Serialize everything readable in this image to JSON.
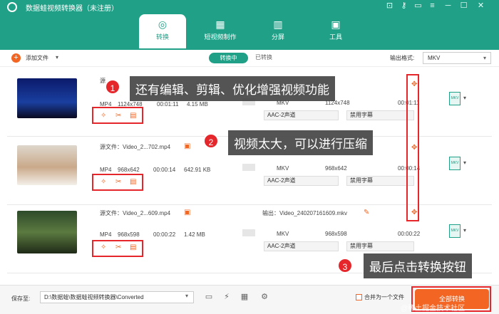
{
  "app": {
    "title": "数据蛙视频转换器（未注册）"
  },
  "tabs": [
    {
      "label": "转换",
      "icon": "convert-icon"
    },
    {
      "label": "短视频制作",
      "icon": "short-video-icon"
    },
    {
      "label": "分屏",
      "icon": "split-screen-icon"
    },
    {
      "label": "工具",
      "icon": "toolbox-icon"
    }
  ],
  "toolbar": {
    "add_files": "添加文件",
    "converting": "转换中",
    "converted": "已转换",
    "output_format_label": "输出格式:",
    "output_format": "MKV"
  },
  "rows": [
    {
      "src": "源",
      "meta_format": "MP4",
      "meta_size": "1124x748",
      "meta_duration": "00:01:11",
      "meta_filesize": "4.15 MB",
      "out_format": "MKV",
      "out_size": "1124x748",
      "out_duration": "00:01:11",
      "audio": "AAC-2声道",
      "subtitle": "禁用字幕"
    },
    {
      "src": "源文件：Video_2...702.mp4",
      "meta_format": "MP4",
      "meta_size": "968x642",
      "meta_duration": "00:00:14",
      "meta_filesize": "642.91 KB",
      "out_format": "MKV",
      "out_size": "968x642",
      "out_duration": "00:00:14",
      "audio": "AAC-2声道",
      "subtitle": "禁用字幕"
    },
    {
      "src": "源文件：Video_2...609.mp4",
      "output": "输出：Video_240207161609.mkv",
      "meta_format": "MP4",
      "meta_size": "968x598",
      "meta_duration": "00:00:22",
      "meta_filesize": "1.42 MB",
      "out_format": "MKV",
      "out_size": "968x598",
      "out_duration": "00:00:22",
      "audio": "AAC-2声道",
      "subtitle": "禁用字幕"
    }
  ],
  "file_icon_text": "MKV",
  "annotations": [
    {
      "num": "1",
      "text": "还有编辑、剪辑、优化增强视频功能"
    },
    {
      "num": "2",
      "text": "视频太大，可以进行压缩"
    },
    {
      "num": "3",
      "text": "最后点击转换按钮"
    }
  ],
  "bottom": {
    "save_label": "保存至:",
    "save_path": "D:\\数据蛙\\数据蛙视频转换器\\Converted",
    "merge_label": "合并为一个文件",
    "convert_all": "全部转换"
  },
  "watermark": "@稀土掘金技术社区",
  "colors": {
    "brand": "#1fa087",
    "accent": "#f26522",
    "annotation": "#e5262a"
  }
}
